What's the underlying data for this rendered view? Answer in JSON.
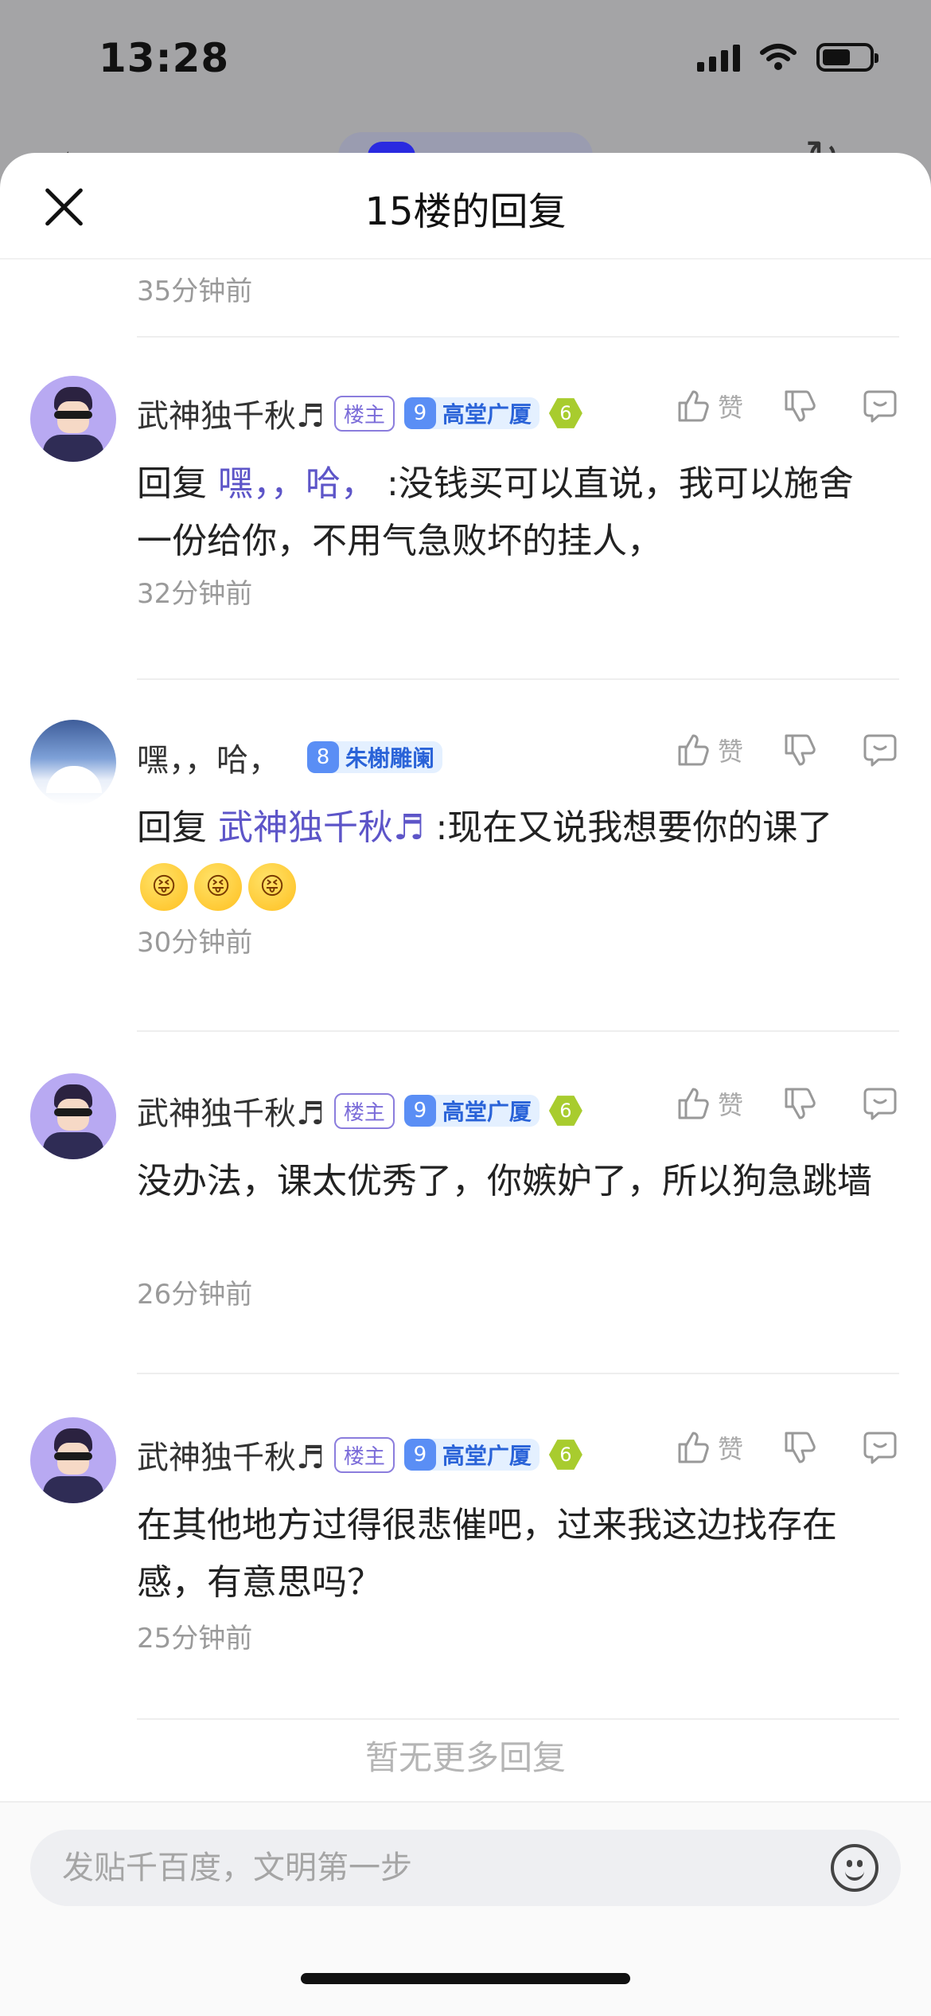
{
  "status_bar": {
    "time": "13:28"
  },
  "header": {
    "title": "15楼的回复"
  },
  "first_timestamp": "35分钟前",
  "replies": [
    {
      "author": "武神独千秋♬",
      "owner_tag": "楼主",
      "level": "9",
      "level_name": "高堂广厦",
      "badge": "6",
      "like_label": "赞",
      "reply_prefix": "回复 ",
      "reply_to": "嘿，，哈，",
      "text": " :没钱买可以直说，我可以施舍一份给你，不用气急败坏的挂人，",
      "time": "32分钟前"
    },
    {
      "author": "嘿，，哈，",
      "level": "8",
      "level_name": "朱榭雕阑",
      "like_label": "赞",
      "reply_prefix": "回复 ",
      "reply_to": "武神独千秋♬",
      "text": " :现在又说我想要你的课了",
      "emojis": [
        "😝",
        "😝",
        "😝"
      ],
      "time": "30分钟前"
    },
    {
      "author": "武神独千秋♬",
      "owner_tag": "楼主",
      "level": "9",
      "level_name": "高堂广厦",
      "badge": "6",
      "like_label": "赞",
      "text": "没办法，课太优秀了，你嫉妒了，所以狗急跳墙",
      "time": "26分钟前"
    },
    {
      "author": "武神独千秋♬",
      "owner_tag": "楼主",
      "level": "9",
      "level_name": "高堂广厦",
      "badge": "6",
      "like_label": "赞",
      "text": "在其他地方过得很悲催吧，过来我这边找存在感，有意思吗？",
      "time": "25分钟前"
    }
  ],
  "no_more": "暂无更多回复",
  "composer": {
    "placeholder": "发贴千百度，文明第一步"
  }
}
